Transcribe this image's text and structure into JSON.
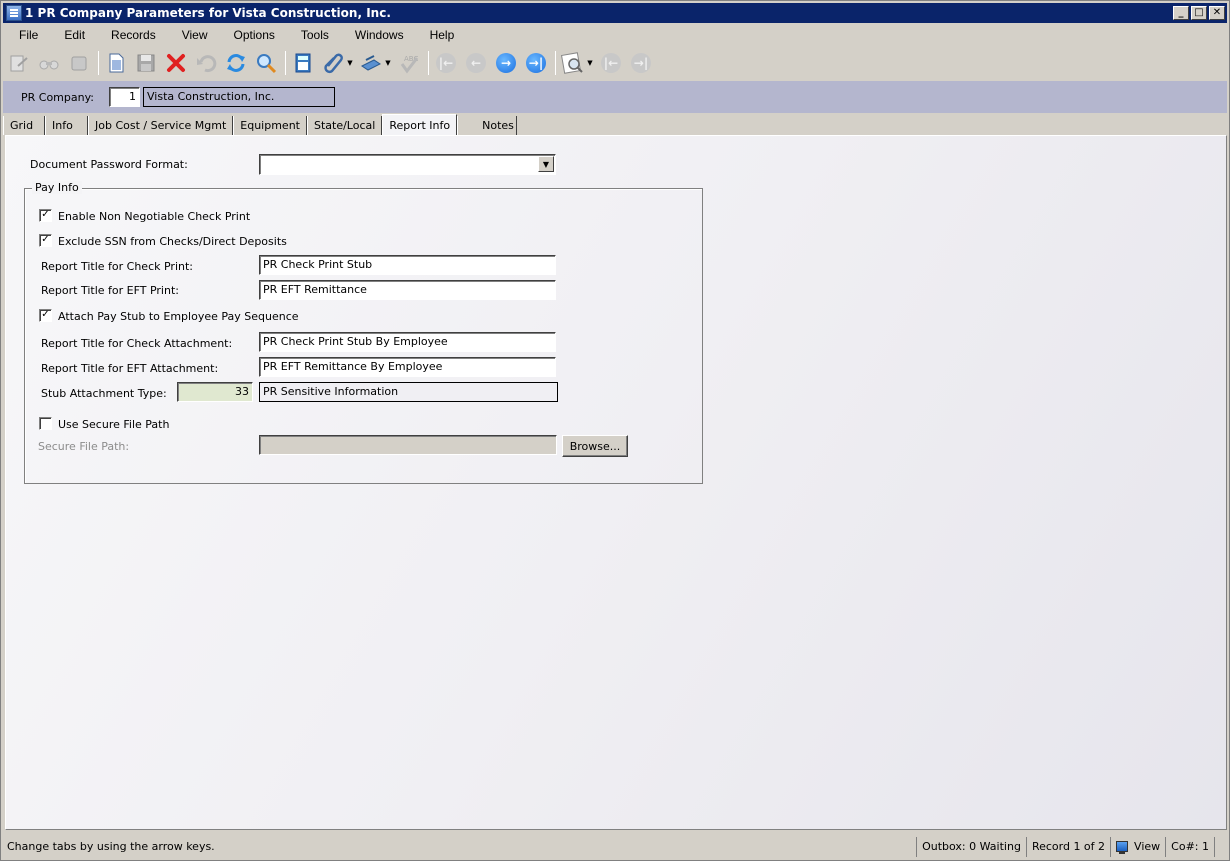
{
  "window": {
    "title": "1 PR Company Parameters for Vista Construction, Inc.",
    "controls": [
      "minimize",
      "maximize",
      "close"
    ]
  },
  "menu": [
    "File",
    "Edit",
    "Records",
    "View",
    "Options",
    "Tools",
    "Windows",
    "Help"
  ],
  "toolbar": {
    "icons": [
      "edit-icon",
      "binoculars-icon",
      "stamp-icon",
      "new-document-icon",
      "save-icon",
      "delete-icon",
      "undo-icon",
      "refresh-icon",
      "search-icon",
      "calculator-icon",
      "attachment-icon",
      "scan-icon",
      "spellcheck-icon",
      "first-record-icon",
      "previous-record-icon",
      "next-record-icon",
      "last-record-icon",
      "lookup-icon",
      "first-related-icon",
      "last-related-icon"
    ]
  },
  "header": {
    "company_label": "PR Company:",
    "company_number": "1",
    "company_name": "Vista Construction, Inc."
  },
  "tabs": [
    {
      "label": "Grid",
      "active": false
    },
    {
      "label": "Info",
      "active": false
    },
    {
      "label": "Job Cost / Service Mgmt",
      "active": false
    },
    {
      "label": "Equipment",
      "active": false
    },
    {
      "label": "State/Local",
      "active": false
    },
    {
      "label": "Report Info",
      "active": true
    },
    {
      "label": "Notes",
      "active": false
    }
  ],
  "form": {
    "doc_password_label": "Document Password Format:",
    "doc_password_value": "",
    "pay_info_title": "Pay Info",
    "enable_non_negotiable": {
      "label": "Enable Non Negotiable Check Print",
      "checked": true
    },
    "exclude_ssn": {
      "label": "Exclude SSN from Checks/Direct Deposits",
      "checked": true
    },
    "check_print_title_label": "Report Title for Check Print:",
    "check_print_title_value": "PR Check Print Stub",
    "eft_print_title_label": "Report Title for EFT Print:",
    "eft_print_title_value": "PR EFT Remittance",
    "attach_pay_stub": {
      "label": "Attach Pay Stub to Employee Pay Sequence",
      "checked": true
    },
    "check_attach_title_label": "Report Title for Check Attachment:",
    "check_attach_title_value": "PR Check Print Stub By Employee",
    "eft_attach_title_label": "Report Title for EFT Attachment:",
    "eft_attach_title_value": "PR EFT Remittance By Employee",
    "stub_type_label": "Stub Attachment Type:",
    "stub_type_code": "33",
    "stub_type_desc": "PR Sensitive Information",
    "use_secure_path": {
      "label": "Use Secure File Path",
      "checked": false
    },
    "secure_path_label": "Secure File Path:",
    "secure_path_value": "",
    "browse_label": "Browse..."
  },
  "status": {
    "message": "Change tabs by using the arrow keys.",
    "outbox": "Outbox: 0 Waiting",
    "record": "Record 1 of 2",
    "mode": "View",
    "company": "Co#: 1"
  }
}
